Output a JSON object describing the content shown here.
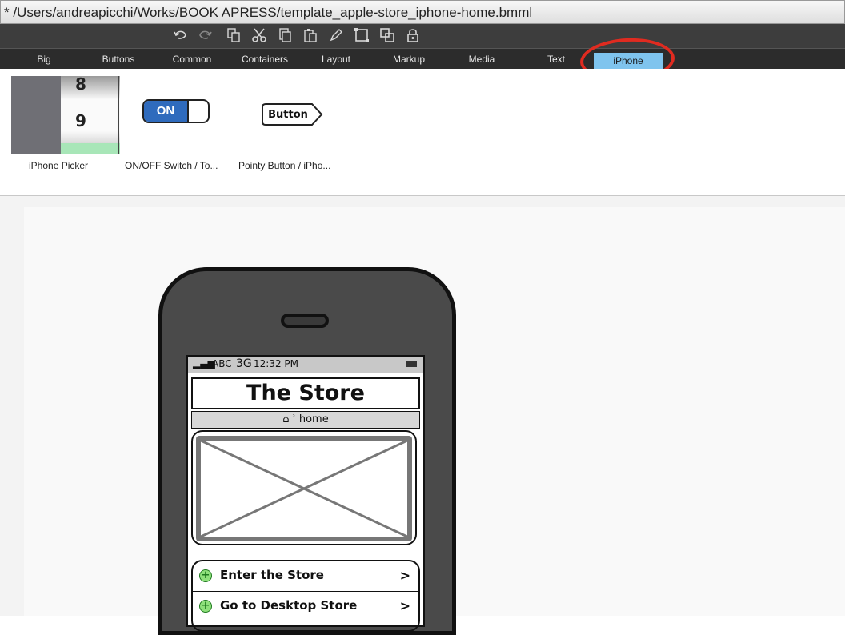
{
  "window": {
    "title": "* /Users/andreapicchi/Works/BOOK APRESS/template_apple-store_iphone-home.bmml"
  },
  "toolbar": {
    "icons": [
      "undo-icon",
      "redo-icon",
      "clone-icon",
      "cut-icon",
      "copy-icon",
      "paste-icon",
      "edit-icon",
      "group-icon",
      "ungroup-icon",
      "lock-icon"
    ]
  },
  "tabs": [
    {
      "label": "Big"
    },
    {
      "label": "Buttons"
    },
    {
      "label": "Common"
    },
    {
      "label": "Containers"
    },
    {
      "label": "Layout"
    },
    {
      "label": "Markup"
    },
    {
      "label": "Media"
    },
    {
      "label": "Text"
    },
    {
      "label": "iPhone",
      "active": true
    }
  ],
  "components": [
    {
      "caption": "iPhone Picker",
      "numbers": [
        "8",
        "9"
      ]
    },
    {
      "caption": "ON/OFF Switch / To...",
      "switch_label": "ON"
    },
    {
      "caption": "Pointy Button / iPho...",
      "button_label": "Button"
    }
  ],
  "mockup": {
    "status": {
      "carrier": "ABC",
      "network": "3G",
      "time": "12:32 PM"
    },
    "title": "The Store",
    "nav": "home",
    "list": [
      {
        "label": "Enter the Store",
        "chevron": ">"
      },
      {
        "label": "Go to Desktop Store",
        "chevron": ">"
      }
    ]
  },
  "colors": {
    "active_tab": "#7fc4ee",
    "highlight_circle": "#e02b20",
    "switch_on": "#2f6bbd",
    "list_plus": "#8ee07b"
  }
}
